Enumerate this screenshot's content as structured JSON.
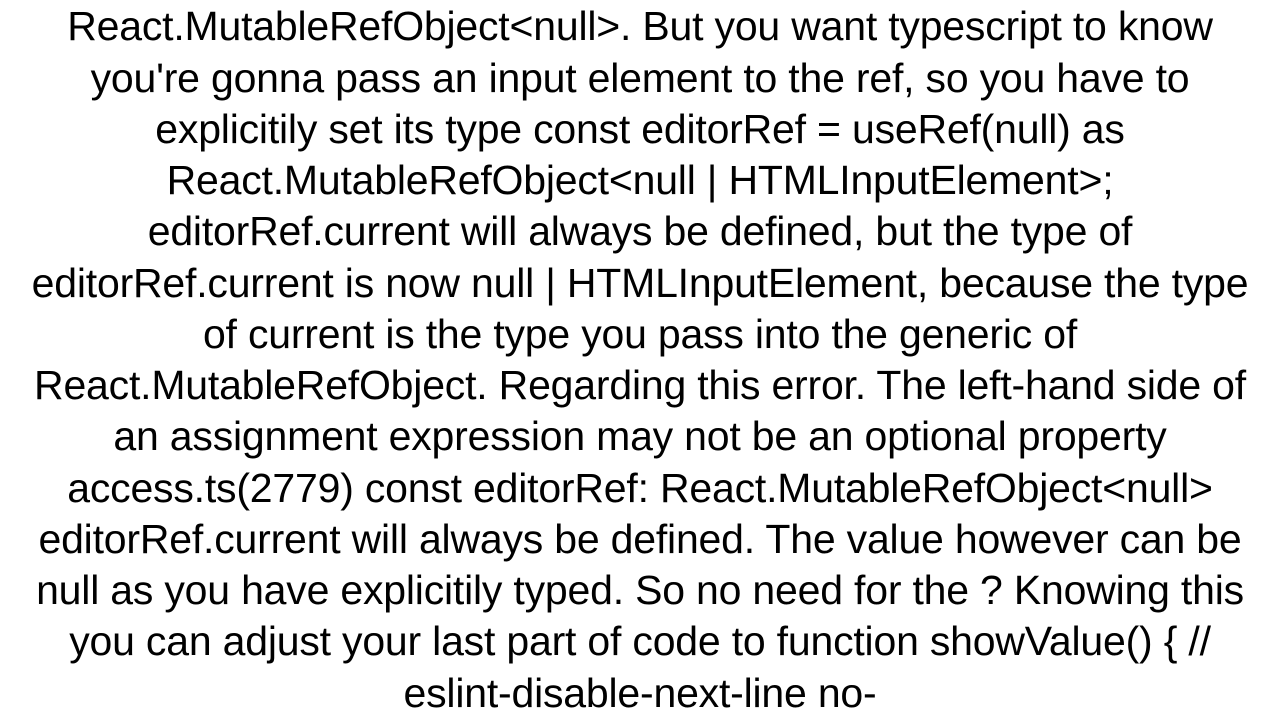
{
  "document": {
    "body_text": "React.MutableRefObject<null>. But you want typescript to know you're gonna pass an input element to the ref, so you have to explicitily set its type const editorRef = useRef(null) as React.MutableRefObject<null | HTMLInputElement>; editorRef.current will always be defined, but the type of editorRef.current is now null | HTMLInputElement, because the type of current is the type you pass into the generic of React.MutableRefObject. Regarding this error. The left-hand side of an assignment expression may not be an optional property access.ts(2779) const editorRef: React.MutableRefObject<null> editorRef.current will always be defined. The value however can be null as you have explicitily typed. So no need for the ? Knowing this you can adjust your last part of code to function showValue() {     // eslint-disable-next-line no-"
  }
}
